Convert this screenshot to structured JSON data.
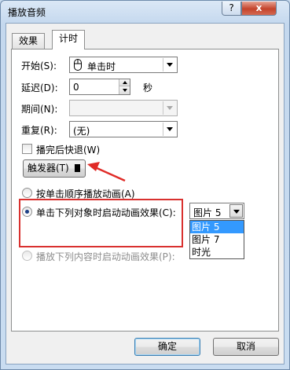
{
  "title": "播放音频",
  "titlebar": {
    "help": "?",
    "close": "x"
  },
  "tabs": [
    {
      "label": "效果",
      "active": false
    },
    {
      "label": "计时",
      "active": true
    }
  ],
  "fields": {
    "start": {
      "label": "开始(S):",
      "value": "单击时",
      "icon": "mouse-icon"
    },
    "delay": {
      "label": "延迟(D):",
      "value": "0",
      "unit": "秒"
    },
    "period": {
      "label": "期间(N):",
      "value": ""
    },
    "repeat": {
      "label": "重复(R):",
      "value": "(无)"
    }
  },
  "rewind_checkbox": {
    "label": "播完后快退(W)",
    "checked": false
  },
  "trigger_button": {
    "label": "触发器(T)"
  },
  "radios": [
    {
      "label": "按单击顺序播放动画(A)",
      "checked": false,
      "disabled": false
    },
    {
      "label": "单击下列对象时启动动画效果(C):",
      "checked": true,
      "disabled": false
    },
    {
      "label": "播放下列内容时启动动画效果(P):",
      "checked": false,
      "disabled": true
    }
  ],
  "object_select": {
    "value": "图片 5",
    "options": [
      "图片 5",
      "图片 7",
      "时光"
    ],
    "selected_index": 0
  },
  "buttons": {
    "ok": "确定",
    "cancel": "取消"
  },
  "colors": {
    "highlight_box": "#d9312f",
    "arrow": "#e02b27",
    "selection": "#3399ff"
  }
}
